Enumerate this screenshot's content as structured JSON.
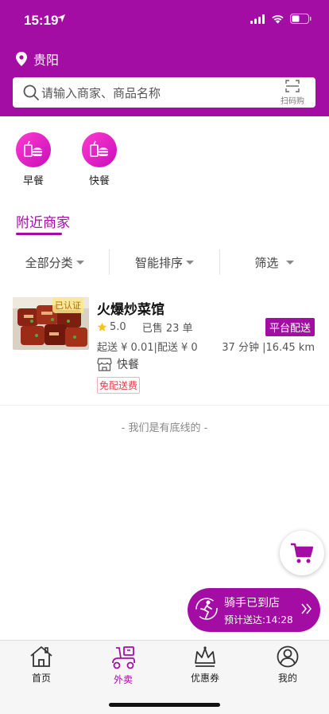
{
  "status_bar": {
    "time": "15:19"
  },
  "header": {
    "location": "贵阳",
    "search_placeholder": "请输入商家、商品名称",
    "scan_label": "扫码购"
  },
  "categories": [
    {
      "label": "早餐",
      "icon": "fast-food-icon"
    },
    {
      "label": "快餐",
      "icon": "fast-food-icon"
    }
  ],
  "section_title": "附近商家",
  "filters": [
    "全部分类",
    "智能排序",
    "筛选"
  ],
  "shop": {
    "name": "火爆炒菜馆",
    "verify_tag": "已认证",
    "rating": "5.0",
    "sold": "已售 23 单",
    "delivery_badge": "平台配送",
    "fees": "起送 ¥ 0.01|配送 ¥ 0",
    "time_distance": "37 分钟 |16.45 km",
    "type": "快餐",
    "free_delivery_tag": "免配送费"
  },
  "bottom_line": "- 我们是有底线的 -",
  "rider": {
    "status": "骑手已到店",
    "eta": "预计送达:14:28"
  },
  "tabs": [
    {
      "label": "首页",
      "icon": "home-icon"
    },
    {
      "label": "外卖",
      "icon": "scooter-icon",
      "active": true
    },
    {
      "label": "优惠券",
      "icon": "crown-icon"
    },
    {
      "label": "我的",
      "icon": "user-icon"
    }
  ],
  "colors": {
    "brand": "#a40da4",
    "tag_red": "#e2424a"
  }
}
